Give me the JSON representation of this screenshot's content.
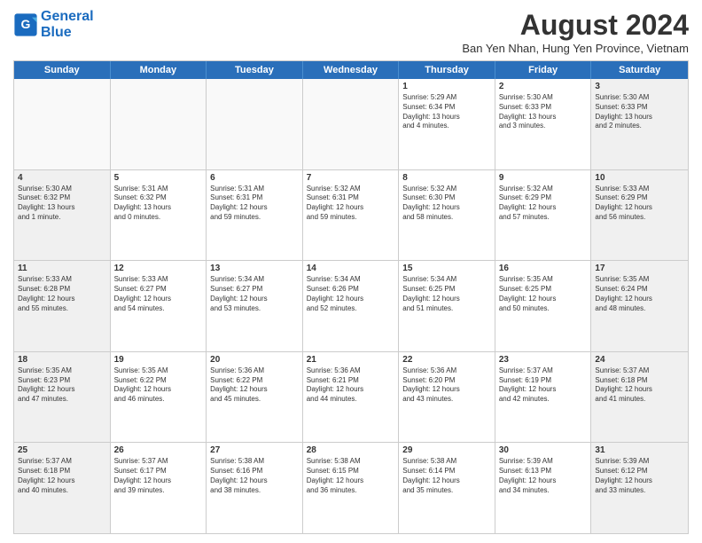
{
  "logo": {
    "line1": "General",
    "line2": "Blue"
  },
  "title": "August 2024",
  "subtitle": "Ban Yen Nhan, Hung Yen Province, Vietnam",
  "weekdays": [
    "Sunday",
    "Monday",
    "Tuesday",
    "Wednesday",
    "Thursday",
    "Friday",
    "Saturday"
  ],
  "weeks": [
    [
      {
        "day": "",
        "text": "",
        "empty": true
      },
      {
        "day": "",
        "text": "",
        "empty": true
      },
      {
        "day": "",
        "text": "",
        "empty": true
      },
      {
        "day": "",
        "text": "",
        "empty": true
      },
      {
        "day": "1",
        "text": "Sunrise: 5:29 AM\nSunset: 6:34 PM\nDaylight: 13 hours\nand 4 minutes.",
        "empty": false,
        "shaded": false
      },
      {
        "day": "2",
        "text": "Sunrise: 5:30 AM\nSunset: 6:33 PM\nDaylight: 13 hours\nand 3 minutes.",
        "empty": false,
        "shaded": false
      },
      {
        "day": "3",
        "text": "Sunrise: 5:30 AM\nSunset: 6:33 PM\nDaylight: 13 hours\nand 2 minutes.",
        "empty": false,
        "shaded": true
      }
    ],
    [
      {
        "day": "4",
        "text": "Sunrise: 5:30 AM\nSunset: 6:32 PM\nDaylight: 13 hours\nand 1 minute.",
        "empty": false,
        "shaded": true
      },
      {
        "day": "5",
        "text": "Sunrise: 5:31 AM\nSunset: 6:32 PM\nDaylight: 13 hours\nand 0 minutes.",
        "empty": false,
        "shaded": false
      },
      {
        "day": "6",
        "text": "Sunrise: 5:31 AM\nSunset: 6:31 PM\nDaylight: 12 hours\nand 59 minutes.",
        "empty": false,
        "shaded": false
      },
      {
        "day": "7",
        "text": "Sunrise: 5:32 AM\nSunset: 6:31 PM\nDaylight: 12 hours\nand 59 minutes.",
        "empty": false,
        "shaded": false
      },
      {
        "day": "8",
        "text": "Sunrise: 5:32 AM\nSunset: 6:30 PM\nDaylight: 12 hours\nand 58 minutes.",
        "empty": false,
        "shaded": false
      },
      {
        "day": "9",
        "text": "Sunrise: 5:32 AM\nSunset: 6:29 PM\nDaylight: 12 hours\nand 57 minutes.",
        "empty": false,
        "shaded": false
      },
      {
        "day": "10",
        "text": "Sunrise: 5:33 AM\nSunset: 6:29 PM\nDaylight: 12 hours\nand 56 minutes.",
        "empty": false,
        "shaded": true
      }
    ],
    [
      {
        "day": "11",
        "text": "Sunrise: 5:33 AM\nSunset: 6:28 PM\nDaylight: 12 hours\nand 55 minutes.",
        "empty": false,
        "shaded": true
      },
      {
        "day": "12",
        "text": "Sunrise: 5:33 AM\nSunset: 6:27 PM\nDaylight: 12 hours\nand 54 minutes.",
        "empty": false,
        "shaded": false
      },
      {
        "day": "13",
        "text": "Sunrise: 5:34 AM\nSunset: 6:27 PM\nDaylight: 12 hours\nand 53 minutes.",
        "empty": false,
        "shaded": false
      },
      {
        "day": "14",
        "text": "Sunrise: 5:34 AM\nSunset: 6:26 PM\nDaylight: 12 hours\nand 52 minutes.",
        "empty": false,
        "shaded": false
      },
      {
        "day": "15",
        "text": "Sunrise: 5:34 AM\nSunset: 6:25 PM\nDaylight: 12 hours\nand 51 minutes.",
        "empty": false,
        "shaded": false
      },
      {
        "day": "16",
        "text": "Sunrise: 5:35 AM\nSunset: 6:25 PM\nDaylight: 12 hours\nand 50 minutes.",
        "empty": false,
        "shaded": false
      },
      {
        "day": "17",
        "text": "Sunrise: 5:35 AM\nSunset: 6:24 PM\nDaylight: 12 hours\nand 48 minutes.",
        "empty": false,
        "shaded": true
      }
    ],
    [
      {
        "day": "18",
        "text": "Sunrise: 5:35 AM\nSunset: 6:23 PM\nDaylight: 12 hours\nand 47 minutes.",
        "empty": false,
        "shaded": true
      },
      {
        "day": "19",
        "text": "Sunrise: 5:35 AM\nSunset: 6:22 PM\nDaylight: 12 hours\nand 46 minutes.",
        "empty": false,
        "shaded": false
      },
      {
        "day": "20",
        "text": "Sunrise: 5:36 AM\nSunset: 6:22 PM\nDaylight: 12 hours\nand 45 minutes.",
        "empty": false,
        "shaded": false
      },
      {
        "day": "21",
        "text": "Sunrise: 5:36 AM\nSunset: 6:21 PM\nDaylight: 12 hours\nand 44 minutes.",
        "empty": false,
        "shaded": false
      },
      {
        "day": "22",
        "text": "Sunrise: 5:36 AM\nSunset: 6:20 PM\nDaylight: 12 hours\nand 43 minutes.",
        "empty": false,
        "shaded": false
      },
      {
        "day": "23",
        "text": "Sunrise: 5:37 AM\nSunset: 6:19 PM\nDaylight: 12 hours\nand 42 minutes.",
        "empty": false,
        "shaded": false
      },
      {
        "day": "24",
        "text": "Sunrise: 5:37 AM\nSunset: 6:18 PM\nDaylight: 12 hours\nand 41 minutes.",
        "empty": false,
        "shaded": true
      }
    ],
    [
      {
        "day": "25",
        "text": "Sunrise: 5:37 AM\nSunset: 6:18 PM\nDaylight: 12 hours\nand 40 minutes.",
        "empty": false,
        "shaded": true
      },
      {
        "day": "26",
        "text": "Sunrise: 5:37 AM\nSunset: 6:17 PM\nDaylight: 12 hours\nand 39 minutes.",
        "empty": false,
        "shaded": false
      },
      {
        "day": "27",
        "text": "Sunrise: 5:38 AM\nSunset: 6:16 PM\nDaylight: 12 hours\nand 38 minutes.",
        "empty": false,
        "shaded": false
      },
      {
        "day": "28",
        "text": "Sunrise: 5:38 AM\nSunset: 6:15 PM\nDaylight: 12 hours\nand 36 minutes.",
        "empty": false,
        "shaded": false
      },
      {
        "day": "29",
        "text": "Sunrise: 5:38 AM\nSunset: 6:14 PM\nDaylight: 12 hours\nand 35 minutes.",
        "empty": false,
        "shaded": false
      },
      {
        "day": "30",
        "text": "Sunrise: 5:39 AM\nSunset: 6:13 PM\nDaylight: 12 hours\nand 34 minutes.",
        "empty": false,
        "shaded": false
      },
      {
        "day": "31",
        "text": "Sunrise: 5:39 AM\nSunset: 6:12 PM\nDaylight: 12 hours\nand 33 minutes.",
        "empty": false,
        "shaded": true
      }
    ]
  ]
}
